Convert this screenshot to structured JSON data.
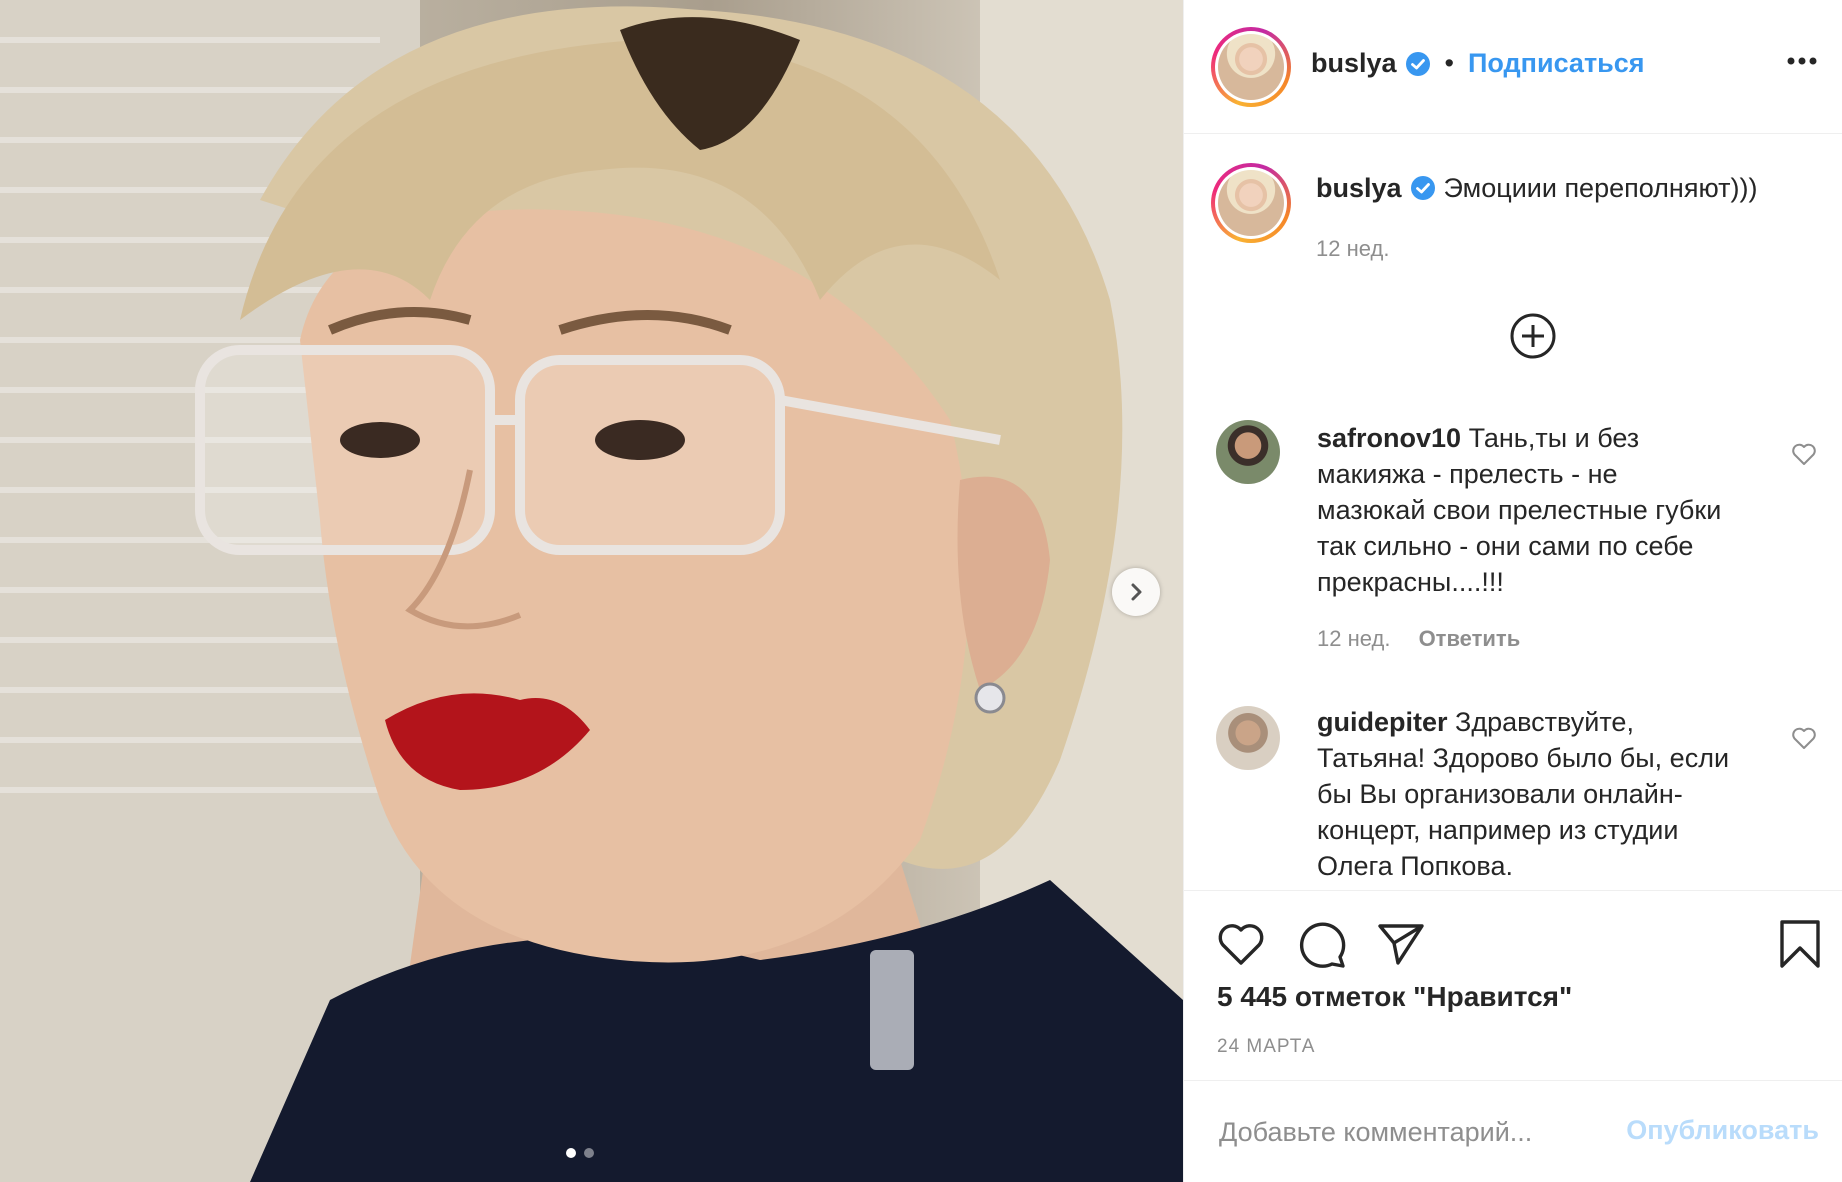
{
  "colors": {
    "accent": "#3897f0",
    "text": "#262626",
    "muted": "#8e8e8e",
    "publish_disabled": "#b9dcfb",
    "verified": "#3897f0",
    "divider": "#efefef"
  },
  "media": {
    "carousel_total": 2,
    "carousel_active_index": 0,
    "next_icon": "chevron-right-icon"
  },
  "header": {
    "username": "buslya",
    "separator": "•",
    "follow_label": "Подписаться",
    "more_icon": "more-options-icon"
  },
  "caption": {
    "username": "buslya",
    "text": "Эмоциии переполняют)))",
    "time": "12 нед."
  },
  "load_more_icon": "plus-circle-icon",
  "comments": [
    {
      "username": "safronov10",
      "lines": [
        "Тань,ты и без",
        "макияжа - прелесть - не",
        "мазюкай свои прелестные губки",
        "так сильно - они сами по себе",
        "прекрасны....!!!"
      ],
      "time": "12 нед.",
      "reply_label": "Ответить"
    },
    {
      "username": "guidepiter",
      "lines": [
        "Здравствуйте,",
        "Татьяна! Здорово было бы, если",
        "бы Вы организовали онлайн-",
        "концерт, например из студии",
        "Олега Попкова."
      ]
    }
  ],
  "actions": {
    "likes": "5 445 отметок \"Нравится\"",
    "date": "24 МАРТА"
  },
  "add_comment": {
    "placeholder": "Добавьте комментарий...",
    "publish_label": "Опубликовать"
  }
}
